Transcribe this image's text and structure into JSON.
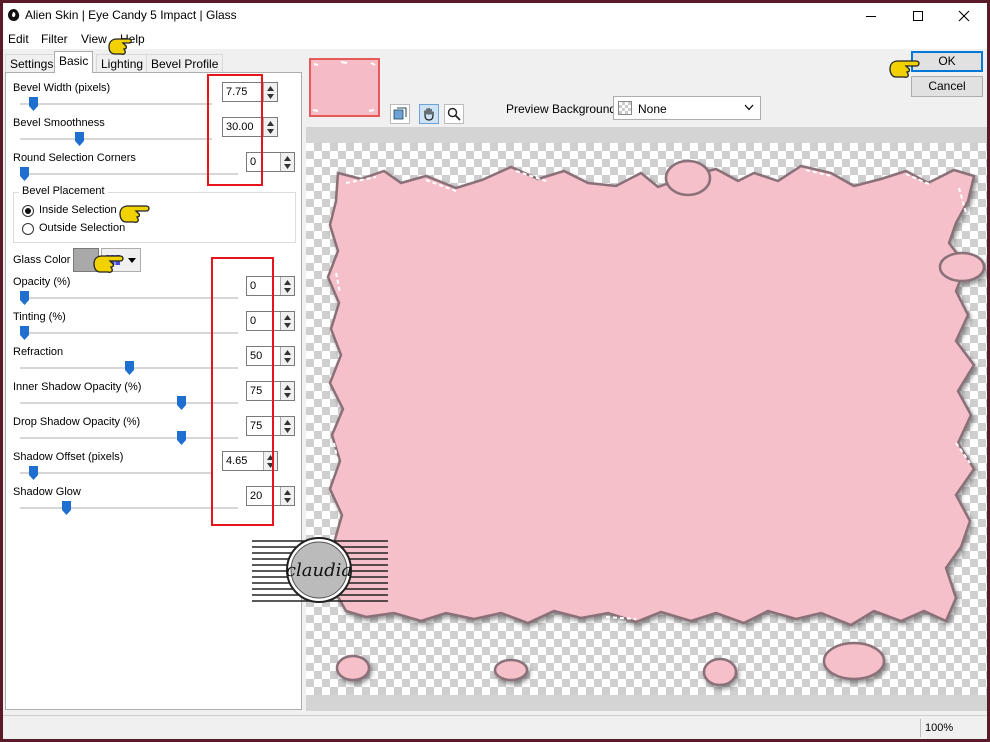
{
  "window": {
    "title": "Alien Skin | Eye Candy 5 Impact | Glass",
    "controls": {
      "minimize": "minimize",
      "maximize": "maximize",
      "close": "close"
    }
  },
  "menu": [
    "Edit",
    "Filter",
    "View",
    "Help"
  ],
  "tabs": [
    "Settings",
    "Basic",
    "Lighting",
    "Bevel Profile"
  ],
  "active_tab": "Basic",
  "params": {
    "bevel_width": {
      "label": "Bevel Width (pixels)",
      "value": "7.75",
      "slider": 0.05
    },
    "bevel_smoothness": {
      "label": "Bevel Smoothness",
      "value": "30.00",
      "slider": 0.3
    },
    "round_corners": {
      "label": "Round Selection Corners",
      "value": "0",
      "slider": 0.0
    },
    "opacity": {
      "label": "Opacity (%)",
      "value": "0",
      "slider": 0.0
    },
    "tinting": {
      "label": "Tinting (%)",
      "value": "0",
      "slider": 0.0
    },
    "refraction": {
      "label": "Refraction",
      "value": "50",
      "slider": 0.5
    },
    "inner_shadow_opacity": {
      "label": "Inner Shadow Opacity (%)",
      "value": "75",
      "slider": 0.75
    },
    "drop_shadow_opacity": {
      "label": "Drop Shadow Opacity (%)",
      "value": "75",
      "slider": 0.75
    },
    "shadow_offset": {
      "label": "Shadow Offset (pixels)",
      "value": "4.65",
      "slider": 0.05
    },
    "shadow_glow": {
      "label": "Shadow Glow",
      "value": "20",
      "slider": 0.2
    }
  },
  "bevel_placement": {
    "legend": "Bevel Placement",
    "options": [
      "Inside Selection",
      "Outside Selection"
    ],
    "selected": "Inside Selection"
  },
  "glass_color": {
    "label": "Glass Color",
    "color": "#a9a9a9"
  },
  "preview_background": {
    "label": "Preview Background:",
    "value": "None"
  },
  "buttons": {
    "ok": "OK",
    "cancel": "Cancel"
  },
  "status": {
    "zoom": "100%"
  },
  "watermark": {
    "text": "claudia"
  },
  "colors": {
    "accent": "#0078d7",
    "highlight_box": "#e8141b",
    "glass_pink": "#f6c1cb",
    "slider_thumb": "#1f6fd1"
  },
  "icons": [
    "app-icon",
    "minimize-icon",
    "maximize-icon",
    "close-icon",
    "preview-toggle-icon",
    "hand-tool-icon",
    "zoom-tool-icon",
    "dropdown-arrow-icon",
    "pointing-hand-icon"
  ]
}
